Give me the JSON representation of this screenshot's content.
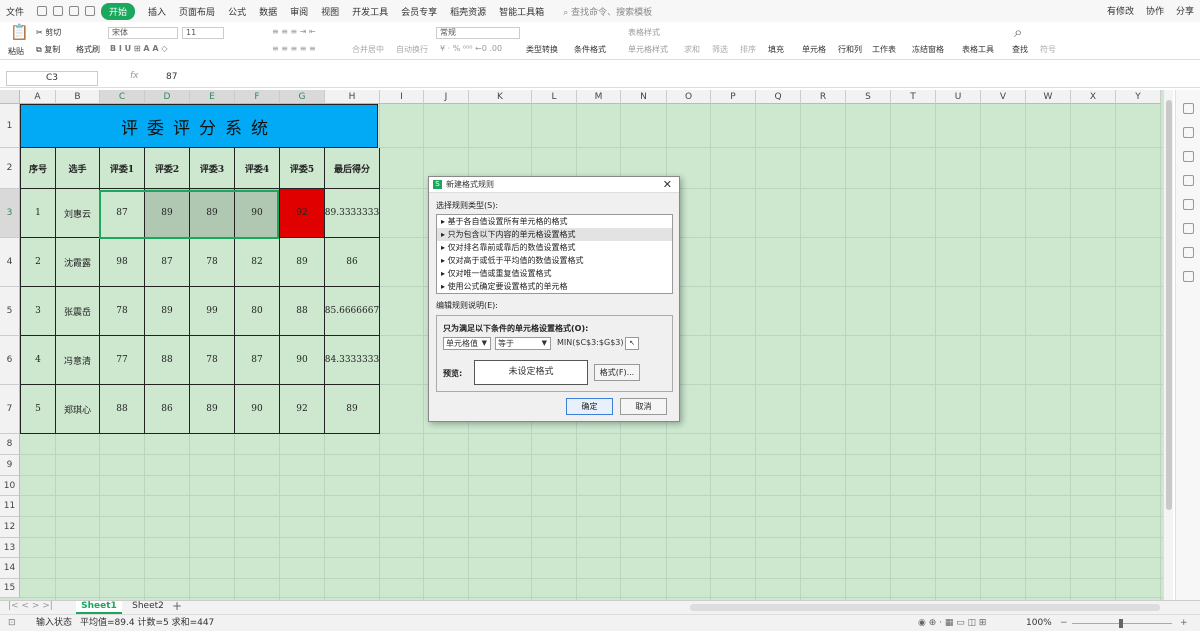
{
  "menu": {
    "file": "文件",
    "tabs": [
      "开始",
      "插入",
      "页面布局",
      "公式",
      "数据",
      "审阅",
      "视图",
      "开发工具",
      "会员专享",
      "稻壳资源",
      "智能工具箱"
    ],
    "active_tab": "开始",
    "search": "查找命令、搜索模板",
    "right": [
      "有修改",
      "协作",
      "分享"
    ]
  },
  "ribbon": {
    "paste": "粘贴",
    "cut": "剪切",
    "copy": "复制",
    "format_painter": "格式刷",
    "font": "宋体",
    "font_size": "11",
    "merge_center": "合并居中",
    "wrap_text": "自动换行",
    "number_format": "常规",
    "type_convert": "类型转换",
    "cond_format": "条件格式",
    "table_style": "表格样式",
    "cell_style": "单元格样式",
    "sum": "求和",
    "filter": "筛选",
    "sort": "排序",
    "fill": "填充",
    "cell": "单元格",
    "row_col": "行和列",
    "worksheet": "工作表",
    "freeze": "冻结窗格",
    "table_tools": "表格工具",
    "find": "查找",
    "symbol": "符号"
  },
  "formula_bar": {
    "cell_ref": "C3",
    "fx": "fx",
    "value": "87"
  },
  "columns": [
    "A",
    "B",
    "C",
    "D",
    "E",
    "F",
    "G",
    "H",
    "I",
    "J",
    "K",
    "L",
    "M",
    "N",
    "O",
    "P",
    "Q",
    "R",
    "S",
    "T",
    "U",
    "V",
    "W",
    "X",
    "Y"
  ],
  "rows": [
    "1",
    "2",
    "3",
    "4",
    "5",
    "6",
    "7",
    "8",
    "9",
    "10",
    "11",
    "12",
    "13",
    "14",
    "15"
  ],
  "sheet": {
    "title": "评委评分系统",
    "headers": [
      "序号",
      "选手",
      "评委1",
      "评委2",
      "评委3",
      "评委4",
      "评委5",
      "最后得分"
    ],
    "data": [
      [
        "1",
        "刘惠云",
        "87",
        "89",
        "89",
        "90",
        "92",
        "89.3333333"
      ],
      [
        "2",
        "沈霞露",
        "98",
        "87",
        "78",
        "82",
        "89",
        "86"
      ],
      [
        "3",
        "张震岳",
        "78",
        "89",
        "99",
        "80",
        "88",
        "85.6666667"
      ],
      [
        "4",
        "冯意清",
        "77",
        "88",
        "78",
        "87",
        "90",
        "84.3333333"
      ],
      [
        "5",
        "郑琪心",
        "88",
        "86",
        "89",
        "90",
        "92",
        "89"
      ]
    ]
  },
  "colors": {
    "title_bg": "#02a9f4",
    "highlight_red": "#e00000",
    "grid_bg": "#cde8cf",
    "active_tab": "#1aa85c"
  },
  "dialog": {
    "title": "新建格式规则",
    "close": "✕",
    "select_type_label": "选择规则类型(S):",
    "rule_types": [
      "基于各自值设置所有单元格的格式",
      "只为包含以下内容的单元格设置格式",
      "仅对排名靠前或靠后的数值设置格式",
      "仅对高于或低于平均值的数值设置格式",
      "仅对唯一值或重复值设置格式",
      "使用公式确定要设置格式的单元格"
    ],
    "edit_label": "编辑规则说明(E):",
    "condition_label": "只为满足以下条件的单元格设置格式(O):",
    "condition_type": "单元格值",
    "operator": "等于",
    "formula": "MIN($C$3:$G$3)",
    "preview_label": "预览:",
    "preview_text": "未设定格式",
    "format_button": "格式(F)...",
    "ok": "确定",
    "cancel": "取消"
  },
  "sheet_tabs": [
    "Sheet1",
    "Sheet2"
  ],
  "status": {
    "mode": "输入状态",
    "stats": "平均值=89.4  计数=5  求和=447",
    "zoom": "100%"
  }
}
